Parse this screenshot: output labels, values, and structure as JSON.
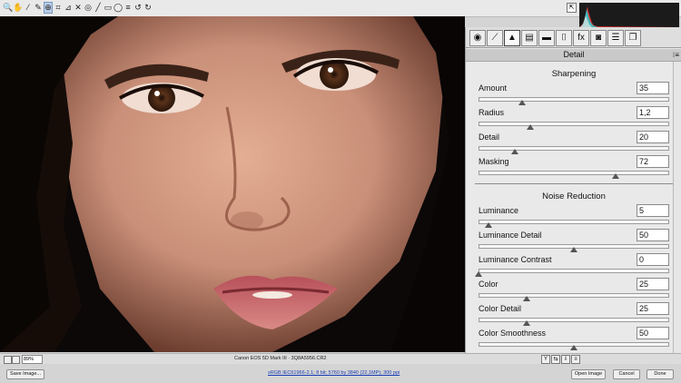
{
  "toolbar": {
    "tools": [
      {
        "name": "zoom-tool-icon",
        "glyph": "🔍"
      },
      {
        "name": "hand-tool-icon",
        "glyph": "✋"
      },
      {
        "name": "white-balance-tool-icon",
        "glyph": "⁄"
      },
      {
        "name": "color-sampler-tool-icon",
        "glyph": "✎"
      },
      {
        "name": "targeted-adjustment-tool-icon",
        "glyph": "⊕"
      },
      {
        "name": "crop-tool-icon",
        "glyph": "⌗"
      },
      {
        "name": "straighten-tool-icon",
        "glyph": "⊿"
      },
      {
        "name": "spot-removal-tool-icon",
        "glyph": "✕"
      },
      {
        "name": "red-eye-tool-icon",
        "glyph": "◎"
      },
      {
        "name": "adjustment-brush-icon",
        "glyph": "╱"
      },
      {
        "name": "graduated-filter-icon",
        "glyph": "▭"
      },
      {
        "name": "radial-filter-icon",
        "glyph": "◯"
      },
      {
        "name": "preferences-icon",
        "glyph": "≡"
      },
      {
        "name": "rotate-ccw-icon",
        "glyph": "↺"
      },
      {
        "name": "rotate-cw-icon",
        "glyph": "↻"
      }
    ],
    "active_tool": 4,
    "fullscreen_glyph": "⇱"
  },
  "panel": {
    "tabs": [
      {
        "name": "tab-basic-icon",
        "glyph": "◉"
      },
      {
        "name": "tab-tone-curve-icon",
        "glyph": "⟋"
      },
      {
        "name": "tab-detail-icon",
        "glyph": "▲"
      },
      {
        "name": "tab-hsl-icon",
        "glyph": "▤"
      },
      {
        "name": "tab-split-toning-icon",
        "glyph": "▬"
      },
      {
        "name": "tab-lens-corrections-icon",
        "glyph": "⌷"
      },
      {
        "name": "tab-effects-icon",
        "glyph": "fx"
      },
      {
        "name": "tab-camera-calibration-icon",
        "glyph": "◙"
      },
      {
        "name": "tab-presets-icon",
        "glyph": "☰"
      },
      {
        "name": "tab-snapshots-icon",
        "glyph": "❐"
      }
    ],
    "active_tab": 2,
    "title": "Detail",
    "menu_glyph": "⁝≡",
    "sharpening": {
      "heading": "Sharpening",
      "controls": [
        {
          "label": "Amount",
          "value": "35",
          "pos": 0.23
        },
        {
          "label": "Radius",
          "value": "1,2",
          "pos": 0.27
        },
        {
          "label": "Detail",
          "value": "20",
          "pos": 0.19
        },
        {
          "label": "Masking",
          "value": "72",
          "pos": 0.72
        }
      ]
    },
    "noise_reduction": {
      "heading": "Noise Reduction",
      "controls": [
        {
          "label": "Luminance",
          "value": "5",
          "pos": 0.05
        },
        {
          "label": "Luminance Detail",
          "value": "50",
          "pos": 0.5
        },
        {
          "label": "Luminance Contrast",
          "value": "0",
          "pos": 0.0
        },
        {
          "label": "Color",
          "value": "25",
          "pos": 0.25
        },
        {
          "label": "Color Detail",
          "value": "25",
          "pos": 0.25
        },
        {
          "label": "Color Smoothness",
          "value": "50",
          "pos": 0.5
        }
      ]
    }
  },
  "statusbar": {
    "zoom": "89%",
    "camera": "Canon EOS 5D Mark III  ·  3Q8A5956.CR2"
  },
  "bottombar": {
    "save_label": "Save Image...",
    "workflow_link": "sRGB IEC61966-2.1; 8 bit; 5760 by 3840 (22,1MP); 300 ppi",
    "open_label": "Open Image",
    "cancel_label": "Cancel",
    "done_label": "Done"
  },
  "colors": {
    "accent": "#b8cde6",
    "skin": "#c98f78",
    "lips": "#c6605f"
  }
}
